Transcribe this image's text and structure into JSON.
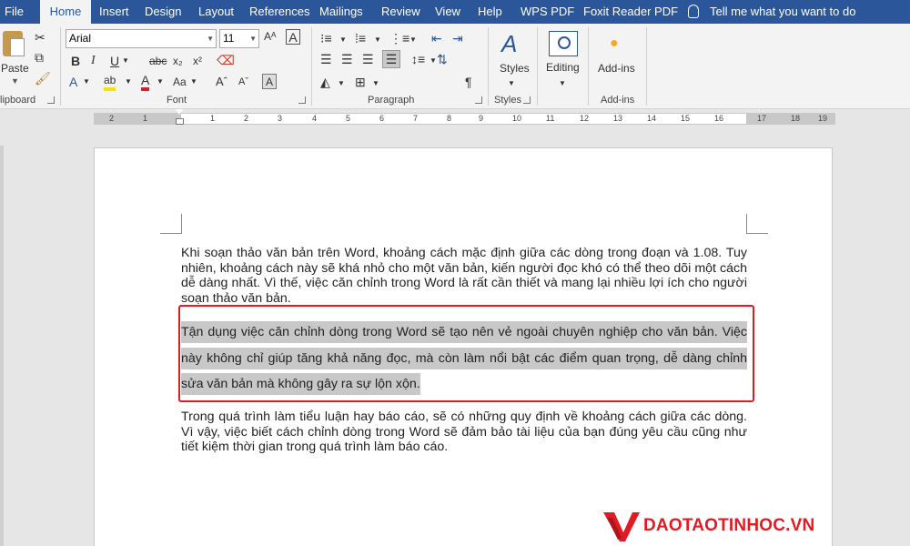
{
  "tabs": {
    "file": "File",
    "home": "Home",
    "insert": "Insert",
    "design": "Design",
    "layout": "Layout",
    "references": "References",
    "mailings": "Mailings",
    "review": "Review",
    "view": "View",
    "help": "Help",
    "wps_pdf": "WPS PDF",
    "foxit": "Foxit Reader PDF",
    "tell_me": "Tell me what you want to do"
  },
  "ribbon": {
    "clipboard": {
      "paste_label": "Paste",
      "group_label": "lipboard"
    },
    "font": {
      "name": "Arial",
      "size": "11",
      "group_label": "Font"
    },
    "paragraph": {
      "group_label": "Paragraph"
    },
    "styles": {
      "button_label": "Styles",
      "group_label": "Styles"
    },
    "editing": {
      "button_label": "Editing"
    },
    "addins": {
      "button_label": "Add-ins",
      "group_label": "Add-ins"
    }
  },
  "ruler": {
    "numbers": [
      "2",
      "1",
      "1",
      "2",
      "3",
      "4",
      "5",
      "6",
      "7",
      "8",
      "9",
      "10",
      "11",
      "12",
      "13",
      "14",
      "15",
      "16",
      "17",
      "18",
      "19"
    ]
  },
  "document": {
    "para1": "Khi soạn thảo văn bản trên Word, khoảng cách mặc định giữa các dòng trong đoạn và 1.08. Tuy nhiên, khoảng cách này sẽ khá nhỏ cho một văn bản, kiến người đọc khó có thể theo dõi một cách dễ dàng nhất. Vì thế, việc căn chỉnh trong Word là rất cần thiết và mang lại nhiều lợi ích cho người soạn thảo văn bản.",
    "para2": "Tận dụng việc căn chỉnh dòng trong Word sẽ tạo nên vẻ ngoài chuyên nghiệp cho văn bản. Việc này không chỉ giúp tăng khả năng đọc, mà còn làm nổi bật các điểm quan trọng, dễ dàng chỉnh sửa văn bản mà không gây ra sự lộn xộn.",
    "para3": "Trong quá trình làm tiểu luận hay báo cáo, sẽ có những quy định về khoảng cách giữa các dòng. Vì vậy, việc biết cách chỉnh dòng trong Word sẽ đảm bảo tài liệu của bạn đúng yêu cầu cũng như tiết kiệm thời gian trong quá trình làm báo cáo."
  },
  "watermark": {
    "text": "DAOTAOTINHOC.VN"
  },
  "colors": {
    "accent": "#2b579a",
    "highlight_border": "#e01b24",
    "selection": "#c8c8c8"
  }
}
